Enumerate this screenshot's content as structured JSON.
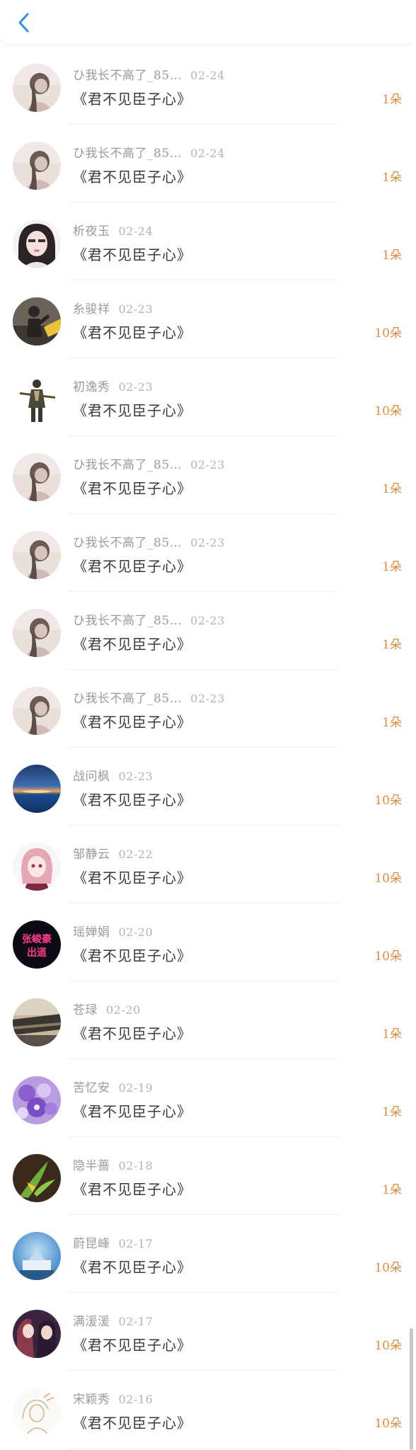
{
  "header": {
    "back_icon": "chevron-left-icon",
    "accent": "#2f8ee8"
  },
  "rows": [
    {
      "name": "ひ我长不高了_85…",
      "date": "02-24",
      "gift": "《君不见臣子心》",
      "count": "1朵",
      "avatar": "girl-sepia"
    },
    {
      "name": "ひ我长不高了_85…",
      "date": "02-24",
      "gift": "《君不见臣子心》",
      "count": "1朵",
      "avatar": "girl-sepia"
    },
    {
      "name": "析夜玉",
      "date": "02-24",
      "gift": "《君不见臣子心》",
      "count": "1朵",
      "avatar": "girl-portrait"
    },
    {
      "name": "糸骏祥",
      "date": "02-23",
      "gift": "《君不见臣子心》",
      "count": "10朵",
      "avatar": "dark-figure"
    },
    {
      "name": "初逸秀",
      "date": "02-23",
      "gift": "《君不见臣子心》",
      "count": "10朵",
      "avatar": "warrior"
    },
    {
      "name": "ひ我长不高了_85…",
      "date": "02-23",
      "gift": "《君不见臣子心》",
      "count": "1朵",
      "avatar": "girl-sepia"
    },
    {
      "name": "ひ我长不高了_85…",
      "date": "02-23",
      "gift": "《君不见臣子心》",
      "count": "1朵",
      "avatar": "girl-sepia"
    },
    {
      "name": "ひ我长不高了_85…",
      "date": "02-23",
      "gift": "《君不见臣子心》",
      "count": "1朵",
      "avatar": "girl-sepia"
    },
    {
      "name": "ひ我长不高了_85…",
      "date": "02-23",
      "gift": "《君不见臣子心》",
      "count": "1朵",
      "avatar": "girl-sepia"
    },
    {
      "name": "战问枫",
      "date": "02-23",
      "gift": "《君不见臣子心》",
      "count": "10朵",
      "avatar": "sunset-sea"
    },
    {
      "name": "邹静云",
      "date": "02-22",
      "gift": "《君不见臣子心》",
      "count": "10朵",
      "avatar": "anime-girl"
    },
    {
      "name": "瑶婵娟",
      "date": "02-20",
      "gift": "《君不见臣子心》",
      "count": "10朵",
      "avatar": "neon-sign",
      "avatar_text": "张峻豪出道"
    },
    {
      "name": "苍琭",
      "date": "02-20",
      "gift": "《君不见臣子心》",
      "count": "1朵",
      "avatar": "city-scene"
    },
    {
      "name": "苦忆安",
      "date": "02-19",
      "gift": "《君不见臣子心》",
      "count": "1朵",
      "avatar": "purple-flowers"
    },
    {
      "name": "隐半蔷",
      "date": "02-18",
      "gift": "《君不见臣子心》",
      "count": "1朵",
      "avatar": "green-plant"
    },
    {
      "name": "蔚昆峰",
      "date": "02-17",
      "gift": "《君不见臣子心》",
      "count": "10朵",
      "avatar": "snow-globe"
    },
    {
      "name": "满湲湲",
      "date": "02-17",
      "gift": "《君不见臣子心》",
      "count": "10朵",
      "avatar": "couple-art"
    },
    {
      "name": "宋颖秀",
      "date": "02-16",
      "gift": "《君不见臣子心》",
      "count": "10朵",
      "avatar": "sketch"
    }
  ]
}
